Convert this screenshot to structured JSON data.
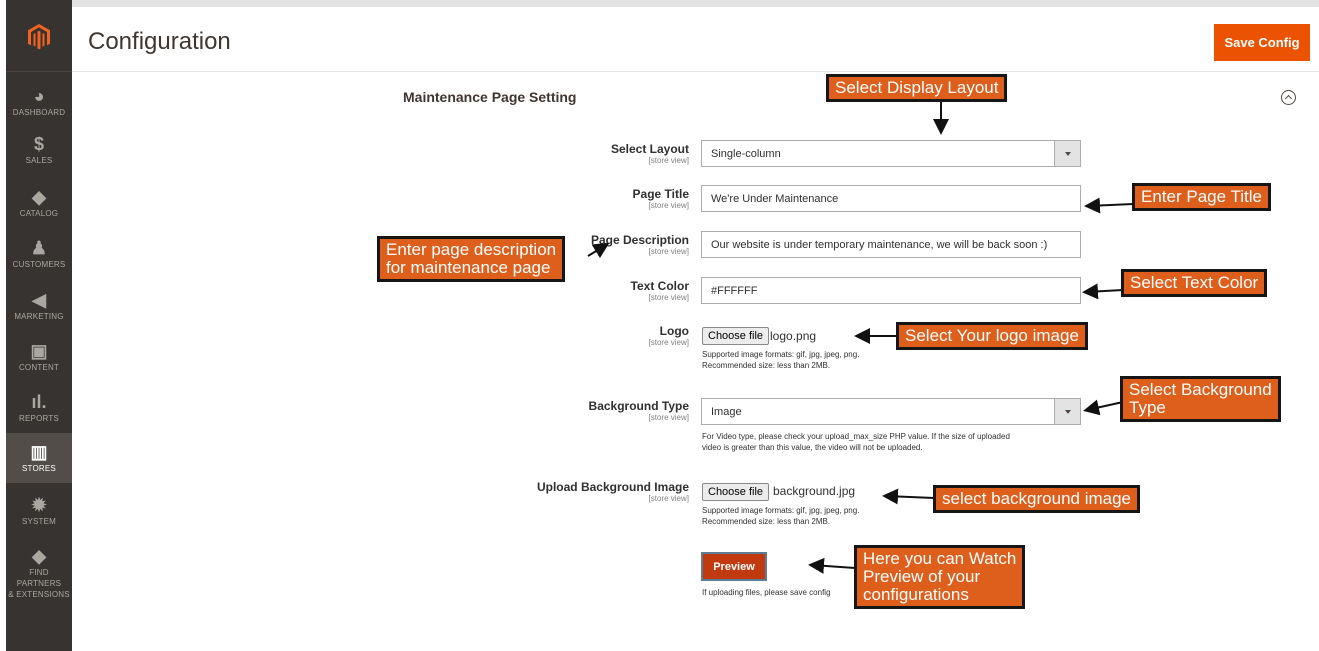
{
  "sidebar": {
    "items": [
      {
        "label": "DASHBOARD",
        "icon": "dashboard-icon"
      },
      {
        "label": "SALES",
        "icon": "dollar-icon"
      },
      {
        "label": "CATALOG",
        "icon": "box-icon"
      },
      {
        "label": "CUSTOMERS",
        "icon": "person-icon"
      },
      {
        "label": "MARKETING",
        "icon": "megaphone-icon"
      },
      {
        "label": "CONTENT",
        "icon": "layout-icon"
      },
      {
        "label": "REPORTS",
        "icon": "bar-chart-icon"
      },
      {
        "label": "STORES",
        "icon": "store-icon"
      },
      {
        "label": "SYSTEM",
        "icon": "gear-icon"
      },
      {
        "label": "FIND PARTNERS",
        "label2": "& EXTENSIONS",
        "icon": "cube-icon"
      }
    ],
    "active": "STORES"
  },
  "header": {
    "title": "Configuration",
    "save_label": "Save Config"
  },
  "section": {
    "title": "Maintenance Page Setting"
  },
  "scope_label": "[store view]",
  "fields": {
    "layout": {
      "label": "Select Layout",
      "value": "Single-column"
    },
    "page_title": {
      "label": "Page Title",
      "value": "We're Under Maintenance"
    },
    "page_description": {
      "label": "Page Description",
      "value": "Our website is under temporary maintenance, we will be back soon :)"
    },
    "text_color": {
      "label": "Text Color",
      "value": "#FFFFFF"
    },
    "logo": {
      "label": "Logo",
      "button": "Choose file",
      "file": "logo.png",
      "note1": "Supported image formats: gif, jpg, jpeg, png.",
      "note2": "Recommended size: less than 2MB."
    },
    "background_type": {
      "label": "Background Type",
      "value": "Image",
      "note1": "For Video type, please check your upload_max_size PHP value. If the size of uploaded",
      "note2": "video is greater than this value, the video will not be uploaded."
    },
    "background_image": {
      "label": "Upload Background Image",
      "button": "Choose file",
      "file": "background.jpg",
      "note1": "Supported image formats: gif, jpg, jpeg, png.",
      "note2": "Recommended size: less than 2MB."
    },
    "preview": {
      "button": "Preview",
      "note": "If uploading files, please save config"
    }
  },
  "callouts": {
    "display_layout": "Select Display Layout",
    "page_title": "Enter Page Title",
    "description_1": "Enter page description",
    "description_2": "for maintenance page",
    "text_color": "Select Text Color",
    "logo": "Select Your logo image",
    "background_type_1": "Select Background",
    "background_type_2": "Type",
    "background_image": "select background image",
    "preview_1": "Here you can Watch",
    "preview_2": "Preview of your",
    "preview_3": "configurations"
  },
  "colors": {
    "sidebar": "#373330",
    "accent": "#eb5202",
    "callout": "#de5e1c",
    "preview": "#c1390e"
  }
}
